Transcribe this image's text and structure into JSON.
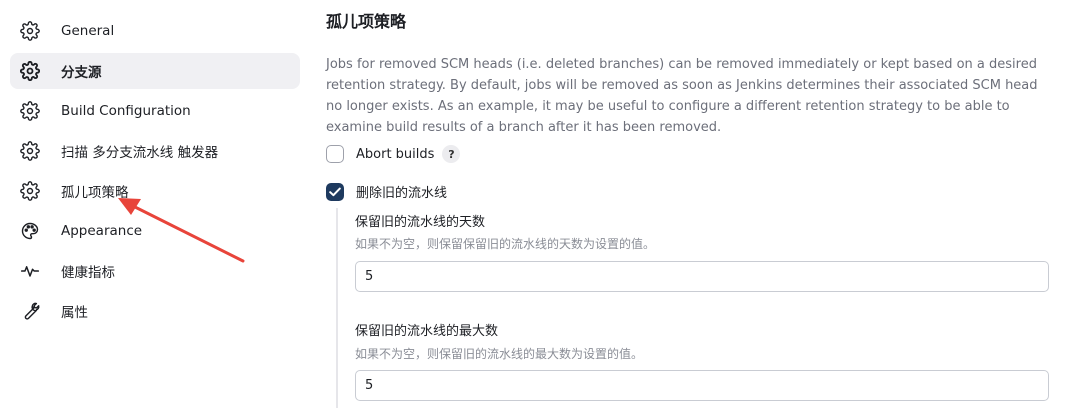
{
  "sidebar": {
    "items": [
      {
        "label": "General",
        "icon": "gear-icon",
        "active": false
      },
      {
        "label": "分支源",
        "icon": "gear-icon",
        "active": true
      },
      {
        "label": "Build Configuration",
        "icon": "gear-icon",
        "active": false
      },
      {
        "label": "扫描 多分支流水线 触发器",
        "icon": "gear-icon",
        "active": false
      },
      {
        "label": "孤儿项策略",
        "icon": "gear-icon",
        "active": false
      },
      {
        "label": "Appearance",
        "icon": "palette-icon",
        "active": false
      },
      {
        "label": "健康指标",
        "icon": "pulse-icon",
        "active": false
      },
      {
        "label": "属性",
        "icon": "wrench-icon",
        "active": false
      }
    ]
  },
  "main": {
    "section_title": "孤儿项策略",
    "description": "Jobs for removed SCM heads (i.e. deleted branches) can be removed immediately or kept based on a desired retention strategy. By default, jobs will be removed as soon as Jenkins determines their associated SCM head no longer exists. As an example, it may be useful to configure a different retention strategy to be able to examine build results of a branch after it has been removed.",
    "abort_builds": {
      "label": "Abort builds",
      "checked": false,
      "help": "?"
    },
    "discard_old": {
      "label": "删除旧的流水线",
      "checked": true
    },
    "days_to_keep": {
      "label": "保留旧的流水线的天数",
      "help": "如果不为空，则保留保留旧的流水线的天数为设置的值。",
      "value": "5"
    },
    "max_to_keep": {
      "label": "保留旧的流水线的最大数",
      "help": "如果不为空，则保留旧的流水线的最大数为设置的值。",
      "value": "5"
    }
  },
  "colors": {
    "accent": "#1e3a5f",
    "annotation_arrow": "#e8443a"
  }
}
